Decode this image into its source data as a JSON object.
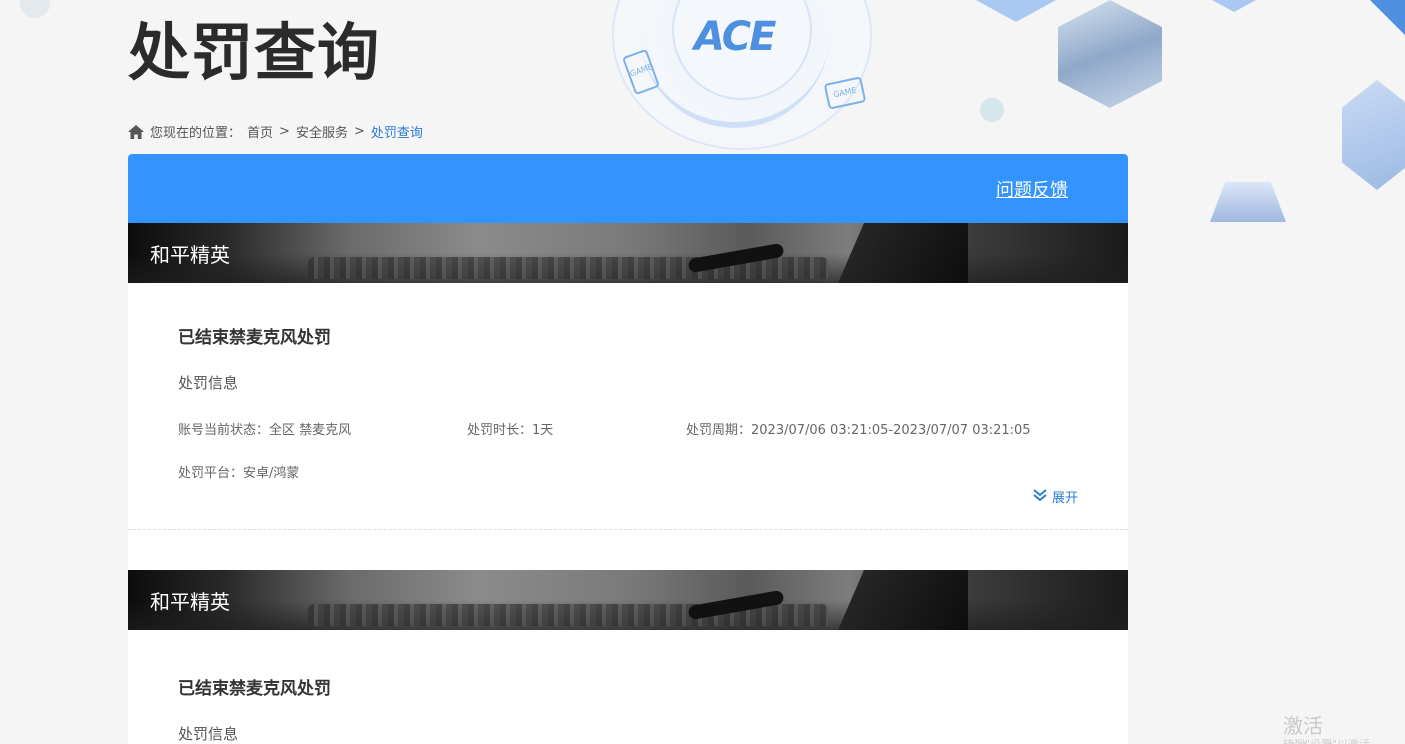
{
  "page": {
    "title": "处罚查询"
  },
  "decor": {
    "logo_text": "ACE",
    "game_icon_text": "GAME"
  },
  "breadcrumb": {
    "prefix": "您现在的位置：",
    "items": [
      "首页",
      "安全服务",
      "处罚查询"
    ],
    "separator": ">"
  },
  "header": {
    "feedback_label": "问题反馈"
  },
  "records": [
    {
      "game": "和平精英",
      "title": "已结束禁麦克风处罚",
      "section": "处罚信息",
      "status": "账号当前状态：全区 禁麦克风",
      "duration": "处罚时长：1天",
      "period": "处罚周期：2023/07/06 03:21:05-2023/07/07 03:21:05",
      "platform": "处罚平台：安卓/鸿蒙",
      "expand_label": "展开"
    },
    {
      "game": "和平精英",
      "title": "已结束禁麦克风处罚",
      "section": "处罚信息"
    }
  ],
  "watermark": {
    "line1": "激活 Windows",
    "line2": "转到\"设置\"以激活 Windows。"
  },
  "colors": {
    "accent": "#3393ff",
    "link": "#2b7bd8"
  }
}
